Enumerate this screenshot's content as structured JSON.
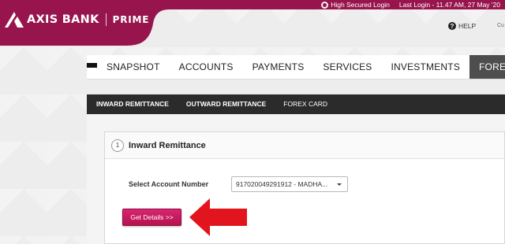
{
  "brand": {
    "name": "AXIS BANK",
    "tier": "PRIME",
    "color": "#97144d"
  },
  "header": {
    "security_label": "High Secured Login",
    "last_login": "Last Login - 11.47 AM, 27 May '20",
    "help_label": "HELP",
    "cu_label": "Cu"
  },
  "nav": {
    "menu_icon": "hamburger-icon",
    "items": [
      {
        "label": "SNAPSHOT"
      },
      {
        "label": "ACCOUNTS"
      },
      {
        "label": "PAYMENTS"
      },
      {
        "label": "SERVICES"
      },
      {
        "label": "INVESTMENTS"
      },
      {
        "label": "FOREX",
        "active": true
      }
    ]
  },
  "subnav": {
    "items": [
      {
        "label": "INWARD REMITTANCE",
        "active": true
      },
      {
        "label": "OUTWARD REMITTANCE"
      },
      {
        "label": "FOREX CARD"
      }
    ]
  },
  "form": {
    "step_number": "1",
    "title": "Inward Remittance",
    "account_label": "Select Account Number",
    "account_value": "917020049291912 - MADHA...",
    "submit_label": "Get Details >>"
  }
}
